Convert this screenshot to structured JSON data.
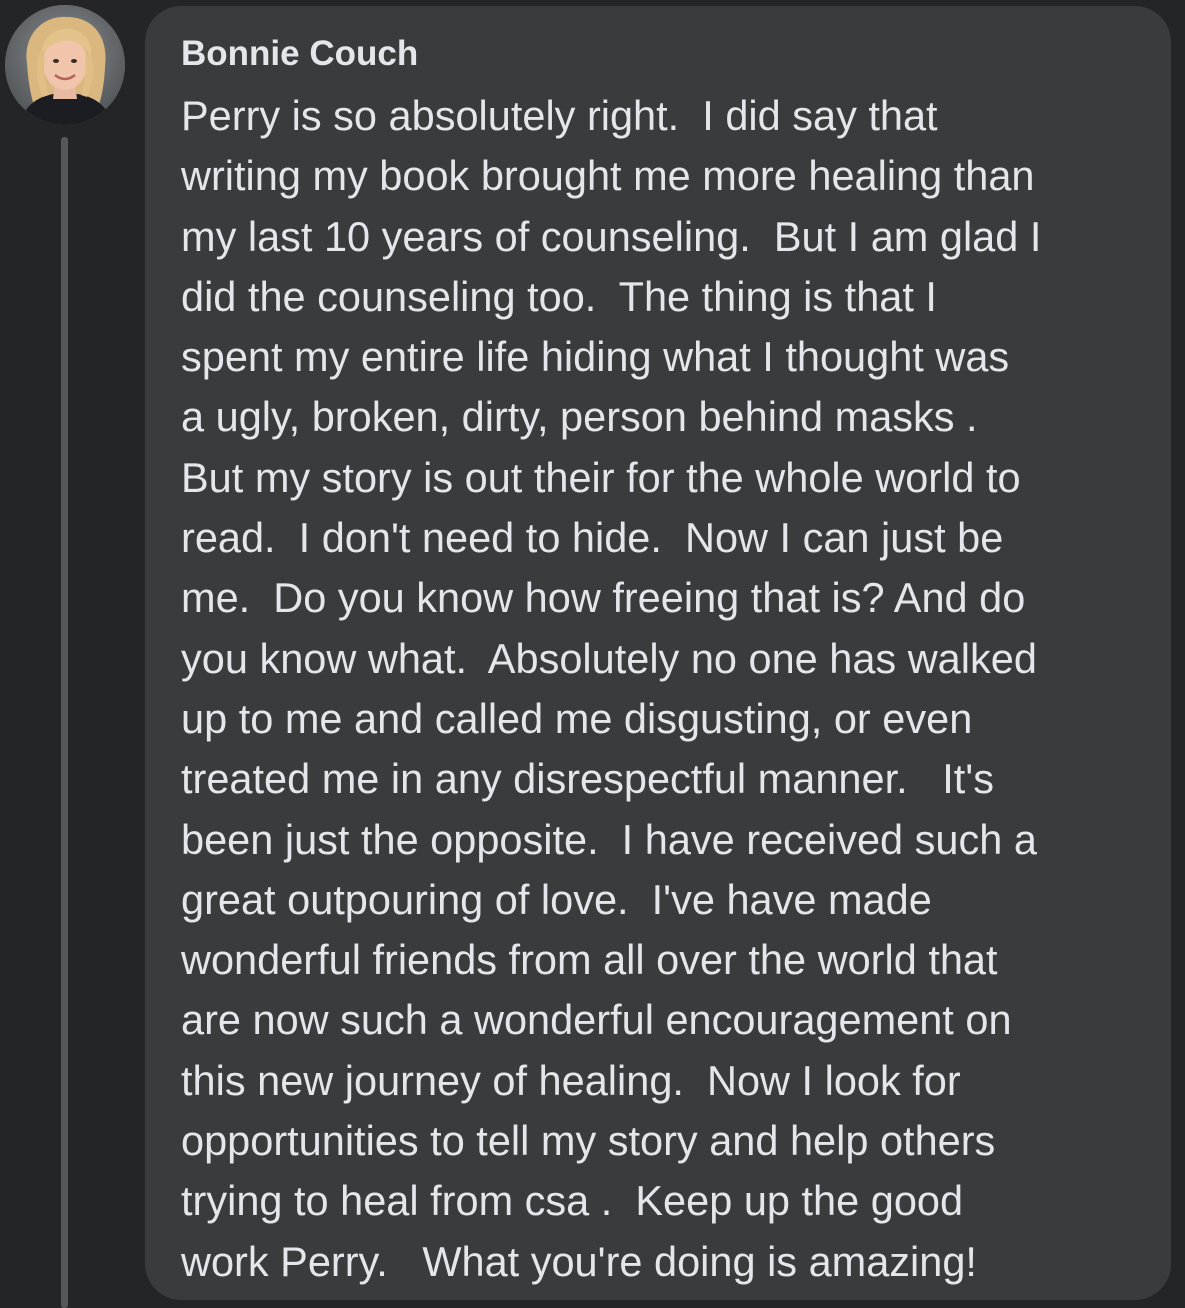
{
  "comment": {
    "author": "Bonnie Couch",
    "lines": [
      "Perry is so absolutely right.  I did say that",
      "writing my book brought me more healing than",
      "my last 10 years of counseling.  But I am glad I",
      "did the counseling too.  The thing is that I",
      "spent my entire life hiding what I thought was",
      "a ugly, broken, dirty, person behind masks .",
      "But my story is out their for the whole world to",
      "read.  I don't need to hide.  Now I can just be",
      "me.  Do you know how freeing that is? And do",
      "you know what.  Absolutely no one has walked",
      "up to me and called me disgusting, or even",
      "treated me in any disrespectful manner.   It's",
      "been just the opposite.  I have received such a",
      "great outpouring of love.  I've have made",
      "wonderful friends from all over the world that",
      "are now such a wonderful encouragement on",
      "this new journey of healing.  Now I look for",
      "opportunities to tell my story and help others",
      "trying to heal from csa .  Keep up the good",
      "work Perry.   What you're doing is amazing!"
    ]
  },
  "colors": {
    "background": "#242526",
    "bubble": "#3a3b3c",
    "text": "#e4e6eb",
    "thread_line": "#55575a"
  },
  "icons": {
    "avatar": "profile-photo"
  }
}
